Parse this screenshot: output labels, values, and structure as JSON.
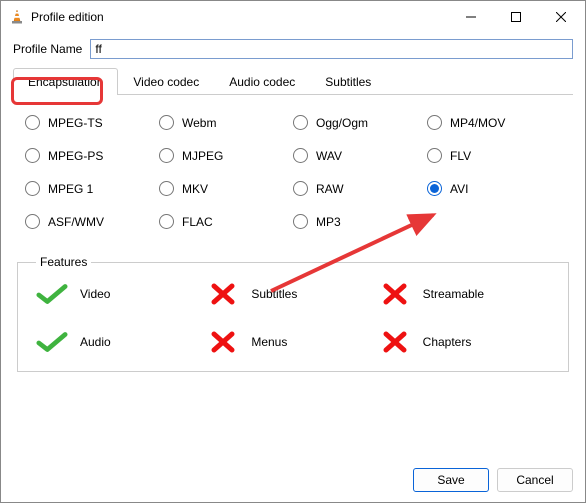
{
  "window": {
    "title": "Profile edition"
  },
  "profile": {
    "label": "Profile Name",
    "value": "ff"
  },
  "tabs": [
    {
      "label": "Encapsulation",
      "active": true
    },
    {
      "label": "Video codec",
      "active": false
    },
    {
      "label": "Audio codec",
      "active": false
    },
    {
      "label": "Subtitles",
      "active": false
    }
  ],
  "encapsulation_options": [
    {
      "label": "MPEG-TS",
      "checked": false
    },
    {
      "label": "Webm",
      "checked": false
    },
    {
      "label": "Ogg/Ogm",
      "checked": false
    },
    {
      "label": "MP4/MOV",
      "checked": false
    },
    {
      "label": "MPEG-PS",
      "checked": false
    },
    {
      "label": "MJPEG",
      "checked": false
    },
    {
      "label": "WAV",
      "checked": false
    },
    {
      "label": "FLV",
      "checked": false
    },
    {
      "label": "MPEG 1",
      "checked": false
    },
    {
      "label": "MKV",
      "checked": false
    },
    {
      "label": "RAW",
      "checked": false
    },
    {
      "label": "AVI",
      "checked": true
    },
    {
      "label": "ASF/WMV",
      "checked": false
    },
    {
      "label": "FLAC",
      "checked": false
    },
    {
      "label": "MP3",
      "checked": false
    }
  ],
  "features": {
    "legend": "Features",
    "items": [
      {
        "label": "Video",
        "supported": true
      },
      {
        "label": "Subtitles",
        "supported": false
      },
      {
        "label": "Streamable",
        "supported": false
      },
      {
        "label": "Audio",
        "supported": true
      },
      {
        "label": "Menus",
        "supported": false
      },
      {
        "label": "Chapters",
        "supported": false
      }
    ]
  },
  "buttons": {
    "save": "Save",
    "cancel": "Cancel"
  },
  "annotation": {
    "arrow_color": "#e63737"
  }
}
